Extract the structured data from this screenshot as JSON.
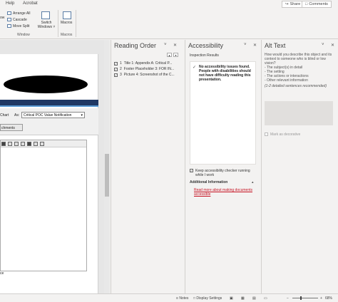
{
  "ribbon": {
    "tabs": [
      "Help",
      "Acrobat"
    ],
    "share_label": "Share",
    "comments_label": "Comments",
    "arrange_all": "Arrange All",
    "cascade": "Cascade",
    "move_split": "Move Split",
    "switch_windows": "Switch Windows ˅",
    "window_group": "Window",
    "macros": "Macros",
    "macros_group": "Macros"
  },
  "slide": {
    "chart_label": "Chart",
    "as_label": "As:",
    "dropdown_value": "Critical POC Value Notification",
    "attachments_button": "chments",
    "footer_fragment": "ce"
  },
  "reading_order": {
    "title": "Reading Order",
    "items": [
      {
        "num": "1",
        "label": "Title 1: Appendix A: Critical P...",
        "checked": true
      },
      {
        "num": "2",
        "label": "Footer Placeholder 3: FOR IN...",
        "checked": true
      },
      {
        "num": "3",
        "label": "Picture 4: Screenshot of the C...",
        "checked": true
      }
    ]
  },
  "accessibility": {
    "title": "Accessibility",
    "inspection_results": "Inspection Results",
    "message": "No accessibility issues found. People with disabilities should not have difficulty reading this presentation.",
    "keep_running": "Keep accessibility checker running while I work",
    "additional_info": "Additional Information",
    "read_more": "Read more about making documents accessible"
  },
  "alt_text": {
    "title": "Alt Text",
    "question": "How would you describe this object and its context to someone who is blind or low vision?",
    "bullets": [
      "- The subject(s) in detail",
      "- The setting",
      "- The actions or interactions",
      "- Other relevant information"
    ],
    "hint": "(1-2 detailed sentences recommended)",
    "mark_decorative": "Mark as decorative"
  },
  "status_bar": {
    "notes": "Notes",
    "display_settings": "Display Settings",
    "zoom": "68%",
    "zoom_value": 68
  },
  "colors": {
    "accent": "#c50f1f",
    "slide_band": "#1f3864"
  }
}
